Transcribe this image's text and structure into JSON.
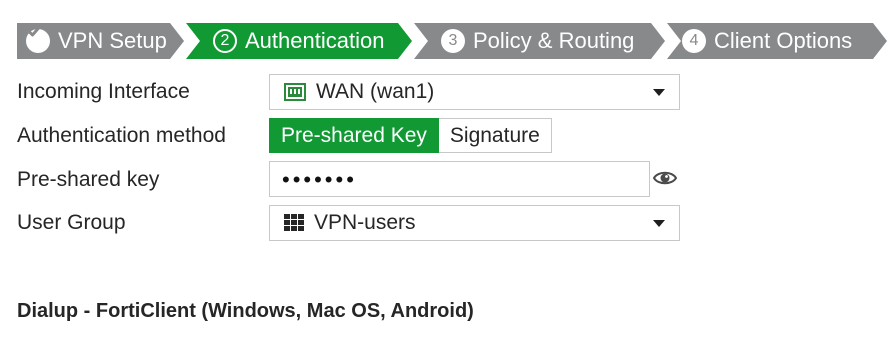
{
  "wizard": {
    "steps": [
      {
        "label": "VPN Setup",
        "state": "done",
        "icon": "check-icon"
      },
      {
        "label": "Authentication",
        "state": "current",
        "number": "2"
      },
      {
        "label": "Policy & Routing",
        "state": "todo",
        "number": "3"
      },
      {
        "label": "Client Options",
        "state": "todo",
        "number": "4"
      }
    ],
    "colors": {
      "done": "#88898b",
      "current": "#119a33",
      "todo": "#88898b"
    }
  },
  "form": {
    "incoming_interface": {
      "label": "Incoming Interface",
      "value": "WAN (wan1)",
      "icon": "network-port-icon"
    },
    "auth_method": {
      "label": "Authentication method",
      "options": [
        "Pre-shared Key",
        "Signature"
      ],
      "selected": "Pre-shared Key"
    },
    "preshared_key": {
      "label": "Pre-shared key",
      "value": "•••••••",
      "reveal_icon": "eye-icon"
    },
    "user_group": {
      "label": "User Group",
      "value": "VPN-users",
      "icon": "user-group-icon"
    }
  },
  "section": {
    "title": "Dialup - FortiClient (Windows, Mac OS, Android)"
  }
}
